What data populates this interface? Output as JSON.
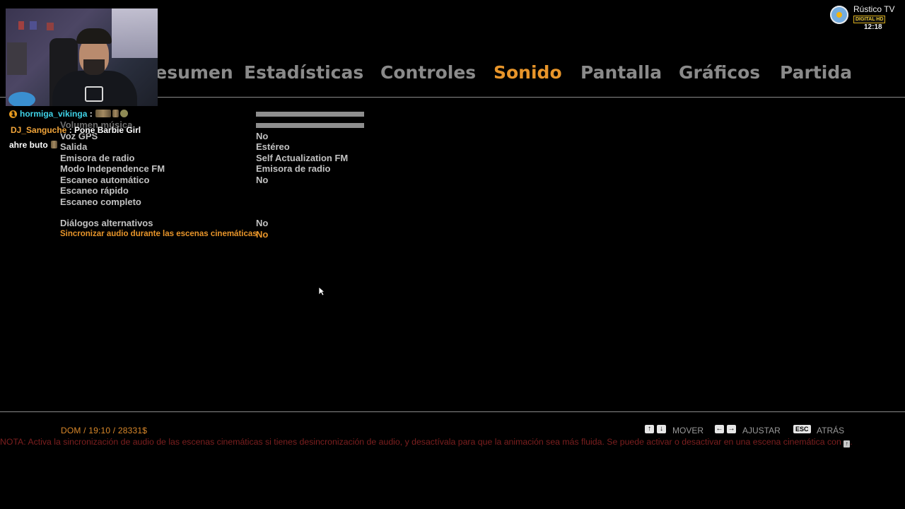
{
  "tabs": [
    {
      "label": "Resumen",
      "active": false
    },
    {
      "label": "Estadísticas",
      "active": false
    },
    {
      "label": "Controles",
      "active": false
    },
    {
      "label": "Sonido",
      "active": true
    },
    {
      "label": "Pantalla",
      "active": false
    },
    {
      "label": "Gráficos",
      "active": false
    },
    {
      "label": "Partida",
      "active": false
    }
  ],
  "settings": {
    "volumen_musica": {
      "label": "Volumen música",
      "level": 1.0
    },
    "efectos": {
      "level": 1.0
    },
    "voz_gps": {
      "label": "Voz GPS",
      "value": "No"
    },
    "salida": {
      "label": "Salida",
      "value": "Estéreo"
    },
    "emisora": {
      "label": "Emisora de radio",
      "value": "Self Actualization FM"
    },
    "independence": {
      "label": "Modo Independence FM",
      "value": "Emisora de radio"
    },
    "escaneo_auto": {
      "label": "Escaneo automático",
      "value": "No"
    },
    "escaneo_rapido": {
      "label": "Escaneo rápido"
    },
    "escaneo_completo": {
      "label": "Escaneo completo"
    },
    "dialogos": {
      "label": "Diálogos alternativos",
      "value": "No"
    },
    "sincronizar": {
      "label": "Sincronizar audio durante las escenas cinemáticas",
      "value": "No"
    }
  },
  "chat": {
    "line1": {
      "user": "hormiga_vikinga",
      "sep": ":",
      "badge": "1"
    },
    "line2": {
      "user": "DJ_Sanguche",
      "sep": ":",
      "message": "Pone Barbie Girl"
    },
    "line3": {
      "message": "ahre buto"
    }
  },
  "channel": {
    "name": "Rústico TV",
    "tag": "DIGITAL HD",
    "time": "12:18"
  },
  "footer": {
    "status": "DOM  /  19:10  /  28331$",
    "hints": {
      "mover": "MOVER",
      "ajustar": "AJUSTAR",
      "esc_key": "ESC",
      "atras": "ATRÁS",
      "up_key": "↑",
      "down_key": "↓",
      "left_key": "←",
      "right_key": "→"
    },
    "note_text": "NOTA: Activa la sincronización de audio de las escenas cinemáticas si tienes desincronización de audio, y desactívala para que la animación sea más fluida. Se puede activar o desactivar en una escena cinemática con",
    "note_key": "↑",
    "note_end": "."
  },
  "colors": {
    "accent": "#e8952a",
    "tab_inactive": "#8a8a8a",
    "note": "#7d1f1f",
    "chat_user1": "#3fd3e8",
    "chat_user2": "#f2a53a"
  },
  "icons": {
    "cursor": "mouse-pointer-icon",
    "channel": "argentina-sun-badge-icon"
  }
}
